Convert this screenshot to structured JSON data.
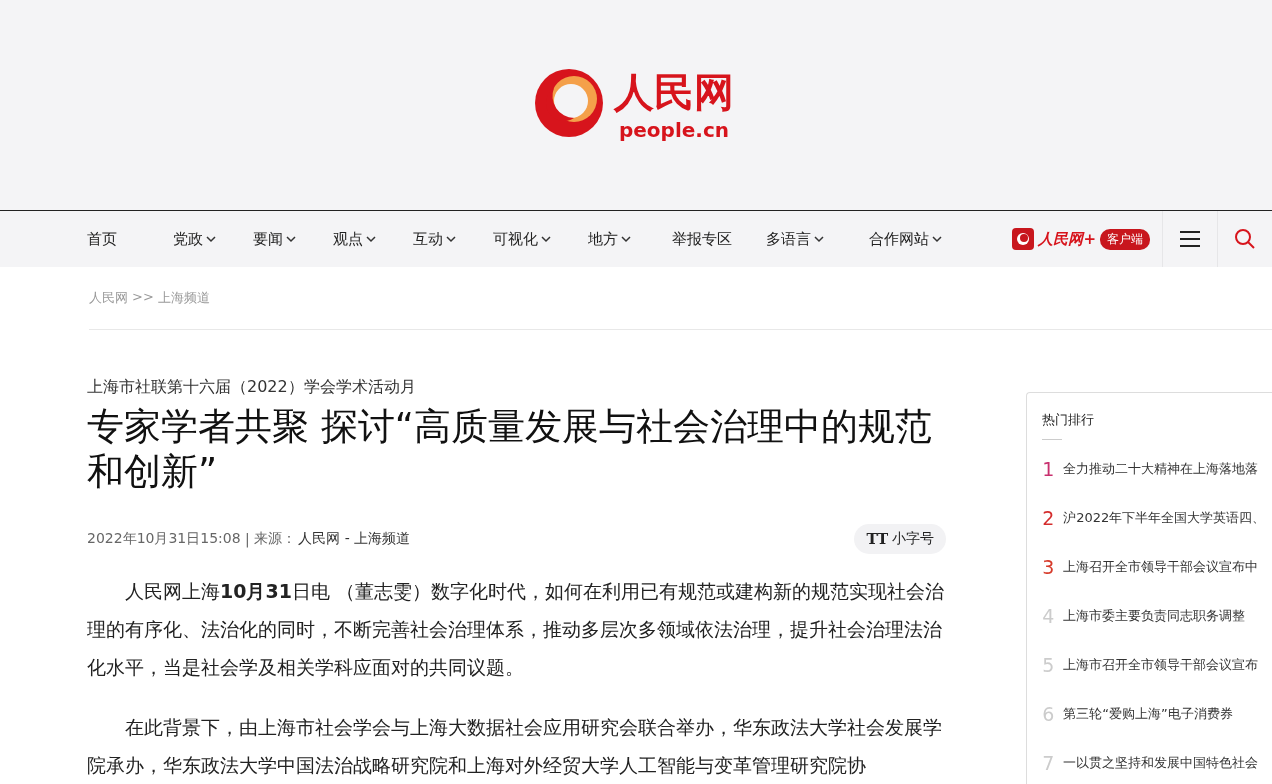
{
  "logo": {
    "name": "人民网",
    "domain": "people.cn"
  },
  "nav": {
    "items": [
      {
        "label": "首页",
        "dropdown": false
      },
      {
        "label": "党政",
        "dropdown": true
      },
      {
        "label": "要闻",
        "dropdown": true
      },
      {
        "label": "观点",
        "dropdown": true
      },
      {
        "label": "互动",
        "dropdown": true
      },
      {
        "label": "可视化",
        "dropdown": true
      },
      {
        "label": "地方",
        "dropdown": true
      },
      {
        "label": "举报专区",
        "dropdown": false
      },
      {
        "label": "多语言",
        "dropdown": true
      },
      {
        "label": "合作网站",
        "dropdown": true
      }
    ],
    "app": {
      "name": "人民网+",
      "badge": "客户端"
    }
  },
  "breadcrumb": [
    "人民网",
    ">>",
    "上海频道"
  ],
  "article": {
    "kicker": "上海市社联第十六届（2022）学会学术活动月",
    "title": "专家学者共聚 探讨“高质量发展与社会治理中的规范和创新”",
    "meta": {
      "date": "2022年10月31日15:08",
      "separator": "|",
      "source_label": "来源：",
      "source": "人民网 - 上海频道"
    },
    "font_button": {
      "icon": "TT",
      "label": "小字号"
    },
    "paragraphs": [
      "人民网上海**10月31**日电 （董志雯）数字化时代，如何在利用已有规范或建构新的规范实现社会治理的有序化、法治化的同时，不断完善社会治理体系，推动多层次多领域依法治理，提升社会治理法治化水平，当是社会学及相关学科应面对的共同议题。",
      "在此背景下，由上海市社会学会与上海大数据社会应用研究会联合举办，华东政法大学社会发展学院承办，华东政法大学中国法治战略研究院和上海对外经贸大学人工智能与变革管理研究院协"
    ]
  },
  "hot": {
    "title": "热门排行",
    "items": [
      {
        "rank": "1",
        "text": "全力推动二十大精神在上海落地落",
        "color": "#c8306e"
      },
      {
        "rank": "2",
        "text": "沪2022年下半年全国大学英语四、",
        "color": "#d42d2d"
      },
      {
        "rank": "3",
        "text": "上海召开全市领导干部会议宣布中",
        "color": "#d63a2a"
      },
      {
        "rank": "4",
        "text": "上海市委主要负责同志职务调整",
        "color": "#cccccc"
      },
      {
        "rank": "5",
        "text": "上海市召开全市领导干部会议宣布",
        "color": "#cccccc"
      },
      {
        "rank": "6",
        "text": "第三轮“爱购上海”电子消费券",
        "color": "#cccccc"
      },
      {
        "rank": "7",
        "text": "一以贯之坚持和发展中国特色社会",
        "color": "#cccccc"
      }
    ]
  }
}
